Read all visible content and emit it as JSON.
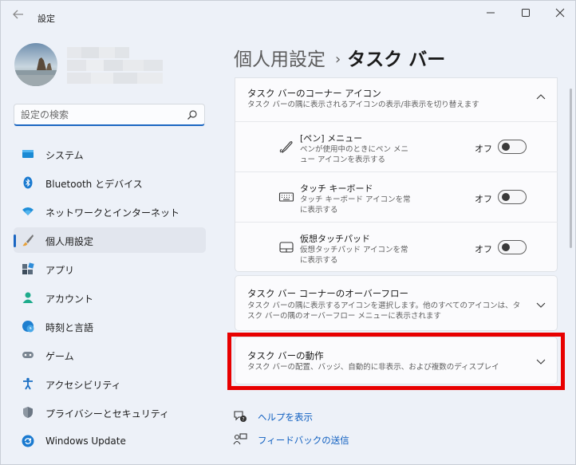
{
  "window": {
    "title": "設定"
  },
  "search": {
    "placeholder": "設定の検索"
  },
  "sidebar": {
    "items": [
      {
        "label": "システム",
        "icon": "system-icon"
      },
      {
        "label": "Bluetooth とデバイス",
        "icon": "bluetooth-icon"
      },
      {
        "label": "ネットワークとインターネット",
        "icon": "network-icon"
      },
      {
        "label": "個人用設定",
        "icon": "personalization-icon",
        "active": true
      },
      {
        "label": "アプリ",
        "icon": "apps-icon"
      },
      {
        "label": "アカウント",
        "icon": "account-icon"
      },
      {
        "label": "時刻と言語",
        "icon": "time-language-icon"
      },
      {
        "label": "ゲーム",
        "icon": "gaming-icon"
      },
      {
        "label": "アクセシビリティ",
        "icon": "accessibility-icon"
      },
      {
        "label": "プライバシーとセキュリティ",
        "icon": "privacy-shield-icon"
      },
      {
        "label": "Windows Update",
        "icon": "windows-update-icon"
      }
    ]
  },
  "breadcrumb": {
    "parent": "個人用設定",
    "separator": "›",
    "current": "タスク バー"
  },
  "sections": {
    "corner_icons": {
      "title": "タスク バーのコーナー アイコン",
      "desc": "タスク バーの隅に表示されるアイコンの表示/非表示を切り替えます",
      "items": [
        {
          "title": "[ペン] メニュー",
          "desc": "ペンが使用中のときにペン メニュー アイコンを表示する",
          "state": "オフ",
          "icon": "pen-icon"
        },
        {
          "title": "タッチ キーボード",
          "desc": "タッチ キーボード アイコンを常に表示する",
          "state": "オフ",
          "icon": "keyboard-icon"
        },
        {
          "title": "仮想タッチパッド",
          "desc": "仮想タッチパッド アイコンを常に表示する",
          "state": "オフ",
          "icon": "touchpad-icon"
        }
      ]
    },
    "overflow": {
      "title": "タスク バー コーナーのオーバーフロー",
      "desc": "タスク バーの隅に表示するアイコンを選択します。他のすべてのアイコンは、タスク バーの隅のオーバーフロー メニューに表示されます"
    },
    "behavior": {
      "title": "タスク バーの動作",
      "desc": "タスク バーの配置、バッジ、自動的に非表示、および複数のディスプレイ"
    }
  },
  "links": {
    "help": "ヘルプを表示",
    "feedback": "フィードバックの送信"
  },
  "colors": {
    "accent": "#1a66c2",
    "highlight": "#e80000",
    "link": "#0f5fc0"
  }
}
